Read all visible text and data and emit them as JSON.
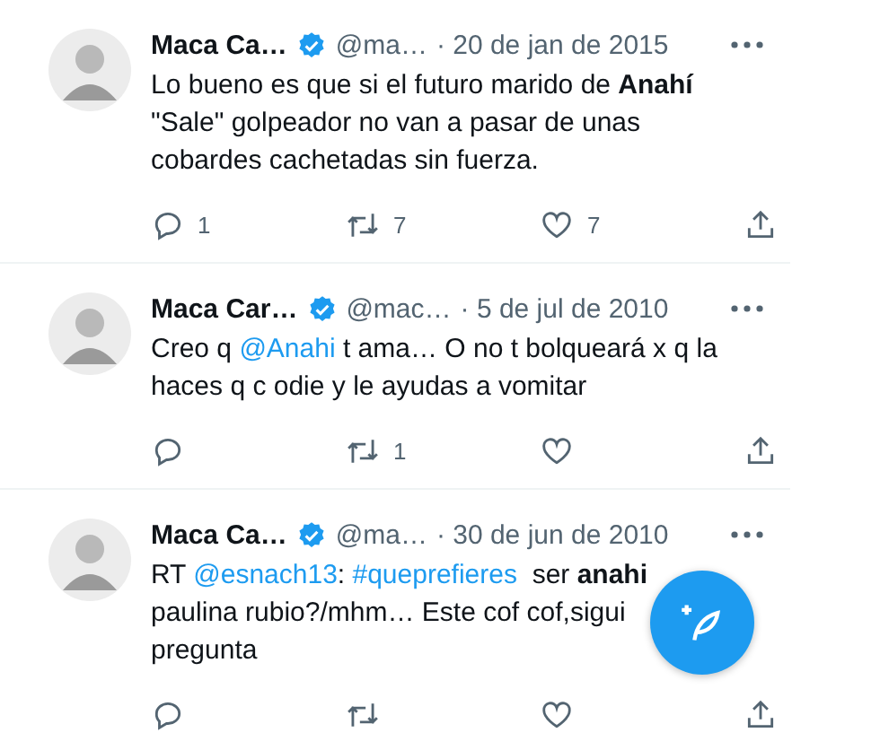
{
  "tweets": [
    {
      "name": "Maca Ca…",
      "handle": "@ma…",
      "date": "· 20 de jan de 2015",
      "verified": true,
      "lines": [
        [
          {
            "kind": "text",
            "text": "Lo bueno es que si el futuro marido de **Anahí**"
          }
        ],
        [
          {
            "kind": "text",
            "text": "\"Sale\" golpeador no van a pasar de unas"
          }
        ],
        [
          {
            "kind": "text",
            "text": "cobardes cachetadas sin fuerza."
          }
        ]
      ],
      "actions": {
        "replies": "1",
        "retweets": "7",
        "likes": "7"
      }
    },
    {
      "name": "Maca Car…",
      "handle": "@mac…",
      "date": "· 5 de jul de 2010",
      "verified": true,
      "lines": [
        [
          {
            "kind": "text",
            "text": "Creo q "
          },
          {
            "kind": "link",
            "text": "@Anahi"
          },
          {
            "kind": "text",
            "text": " t ama… O no t bolqueará x q la"
          }
        ],
        [
          {
            "kind": "text",
            "text": "haces q c odie y le ayudas a vomitar"
          }
        ]
      ],
      "actions": {
        "retweets": "1"
      }
    },
    {
      "name": "Maca Ca…",
      "handle": "@ma…",
      "date": "· 30 de jun de 2010",
      "verified": true,
      "lines": [
        [
          {
            "kind": "text",
            "text": "RT "
          },
          {
            "kind": "link",
            "text": "@esnach13"
          },
          {
            "kind": "text",
            "text": ": "
          },
          {
            "kind": "link",
            "text": "#queprefieres"
          },
          {
            "kind": "text",
            "text": "  ser **anahi**"
          }
        ],
        [
          {
            "kind": "text",
            "text": "paulina rubio?/mhm… Este cof cof,sigui"
          }
        ],
        [
          {
            "kind": "text",
            "text": "pregunta"
          }
        ]
      ]
    }
  ],
  "compose_button": {
    "visible": true
  }
}
